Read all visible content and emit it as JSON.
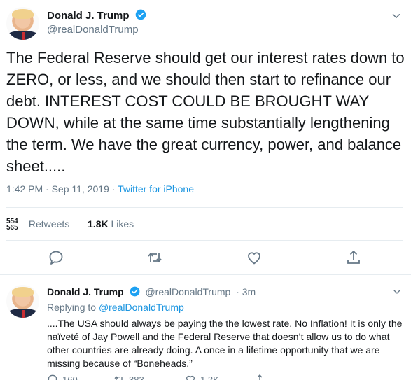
{
  "main_tweet": {
    "author_name": "Donald J. Trump",
    "handle": "@realDonaldTrump",
    "text": "The Federal Reserve should get our interest rates down to ZERO, or less, and we should then start to refinance our debt. INTEREST COST COULD BE BROUGHT WAY DOWN, while at the same time substantially lengthening the term. We have the great currency, power, and balance sheet.....",
    "time": "1:42 PM",
    "separator": " · ",
    "date": "Sep 11, 2019",
    "source": "Twitter for iPhone",
    "retweets_count_partial": "554\n565",
    "retweets_label": "Retweets",
    "likes_count": "1.8K",
    "likes_label": "Likes"
  },
  "reply_tweet": {
    "author_name": "Donald J. Trump",
    "handle": "@realDonaldTrump",
    "age": "· 3m",
    "replying_prefix": "Replying to",
    "replying_to": "@realDonaldTrump",
    "text": "....The USA should always be paying the the lowest rate. No Inflation! It is only the naïveté of Jay Powell and the Federal Reserve that doesn’t allow us to do what other countries are already doing. A once in a lifetime opportunity that we are missing because of “Boneheads.”",
    "reply_count": "160",
    "retweet_count": "383",
    "like_count": "1.2K"
  },
  "icons": {
    "verified": "verified-badge-icon",
    "caret": "chevron-down-icon",
    "reply": "reply-icon",
    "retweet": "retweet-icon",
    "like": "heart-icon",
    "share": "share-icon"
  },
  "colors": {
    "accent": "#1b95e0",
    "muted": "#657786",
    "text": "#14171a",
    "divider": "#e6ecf0"
  }
}
